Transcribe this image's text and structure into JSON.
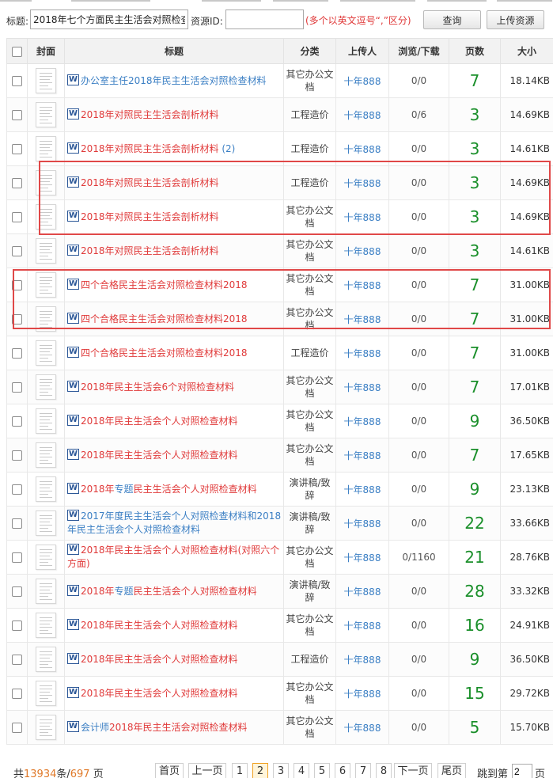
{
  "search": {
    "title_label": "标题:",
    "title_value": "2018年七个方面民主生活会对照检查材料",
    "id_label": "资源ID:",
    "id_value": "",
    "hint": "(多个以英文逗号“,”区分)",
    "query_button": "查询",
    "upload_button": "上传资源"
  },
  "table": {
    "columns": [
      "封面",
      "标题",
      "分类",
      "上传人",
      "浏览/下载",
      "页数",
      "大小"
    ],
    "rows": [
      {
        "title": "办公室主任2018年民主生活会对照检查材料",
        "title_color": "#3b7fc4",
        "category": "其它办公文档",
        "uploader": "十年888",
        "views": "0/0",
        "pages": "7",
        "size": "18.14KB"
      },
      {
        "title": "2018年对照民主生活会剖析材料",
        "category": "工程造价",
        "uploader": "十年888",
        "views": "0/6",
        "pages": "3",
        "size": "14.69KB"
      },
      {
        "title": "2018年对照民主生活会剖析材料",
        "suffix": " (2)",
        "category": "工程造价",
        "uploader": "十年888",
        "views": "0/0",
        "pages": "3",
        "size": "14.61KB"
      },
      {
        "title": "2018年对照民主生活会剖析材料",
        "category": "工程造价",
        "uploader": "十年888",
        "views": "0/0",
        "pages": "3",
        "size": "14.69KB"
      },
      {
        "title": "2018年对照民主生活会剖析材料",
        "category": "其它办公文档",
        "uploader": "十年888",
        "views": "0/0",
        "pages": "3",
        "size": "14.69KB"
      },
      {
        "title": "2018年对照民主生活会剖析材料",
        "category": "其它办公文档",
        "uploader": "十年888",
        "views": "0/0",
        "pages": "3",
        "size": "14.61KB"
      },
      {
        "title": "四个合格民主生活会对照检查材料2018",
        "category": "其它办公文档",
        "uploader": "十年888",
        "views": "0/0",
        "pages": "7",
        "size": "31.00KB"
      },
      {
        "title": "四个合格民主生活会对照检查材料2018",
        "category": "其它办公文档",
        "uploader": "十年888",
        "views": "0/0",
        "pages": "7",
        "size": "31.00KB"
      },
      {
        "title": "四个合格民主生活会对照检查材料2018",
        "category": "工程造价",
        "uploader": "十年888",
        "views": "0/0",
        "pages": "7",
        "size": "31.00KB"
      },
      {
        "title": "2018年民主生活会6个对照检查材料",
        "category": "其它办公文档",
        "uploader": "十年888",
        "views": "0/0",
        "pages": "7",
        "size": "17.01KB"
      },
      {
        "title": "2018年民主生活会个人对照检查材料",
        "category": "其它办公文档",
        "uploader": "十年888",
        "views": "0/0",
        "pages": "9",
        "size": "36.50KB"
      },
      {
        "title": "2018年民主生活会个人对照检查材料",
        "category": "其它办公文档",
        "uploader": "十年888",
        "views": "0/0",
        "pages": "7",
        "size": "17.65KB"
      },
      {
        "title_parts": [
          [
            "2018年",
            "r"
          ],
          [
            "专题",
            "b"
          ],
          [
            "民主生活会个人对照检查材料",
            "r"
          ]
        ],
        "title": "2018年专题民主生活会个人对照检查材料",
        "category": "演讲稿/致辞",
        "uploader": "十年888",
        "views": "0/0",
        "pages": "9",
        "size": "23.13KB"
      },
      {
        "title_parts": [
          [
            "2017年度民主生活会个人对照检查材料和2018年民主生活会个人对照检查材料",
            "b"
          ]
        ],
        "title": "2017年度民主生活会个人对照检查材料和2018年民主生活会个人对照检查材料",
        "category": "演讲稿/致辞",
        "uploader": "十年888",
        "views": "0/0",
        "pages": "22",
        "size": "33.66KB"
      },
      {
        "title": "2018年民主生活会个人对照检查材料(对照六个方面)",
        "category": "其它办公文档",
        "uploader": "十年888",
        "views": "0/1160",
        "pages": "21",
        "size": "28.76KB"
      },
      {
        "title_parts": [
          [
            "2018年",
            "r"
          ],
          [
            "专题",
            "b"
          ],
          [
            "民主生活会个人对照检查材料",
            "r"
          ]
        ],
        "title": "2018年专题民主生活会个人对照检查材料",
        "category": "演讲稿/致辞",
        "uploader": "十年888",
        "views": "0/0",
        "pages": "28",
        "size": "33.32KB"
      },
      {
        "title": "2018年民主生活会个人对照检查材料",
        "category": "其它办公文档",
        "uploader": "十年888",
        "views": "0/0",
        "pages": "16",
        "size": "24.91KB"
      },
      {
        "title": "2018年民主生活会个人对照检查材料",
        "category": "工程造价",
        "uploader": "十年888",
        "views": "0/0",
        "pages": "9",
        "size": "36.50KB"
      },
      {
        "title": "2018年民主生活会个人对照检查材料",
        "category": "其它办公文档",
        "uploader": "十年888",
        "views": "0/0",
        "pages": "15",
        "size": "29.72KB"
      },
      {
        "title_parts": [
          [
            "会计师",
            "b"
          ],
          [
            "2018年民主生活会对照检查材料",
            "r"
          ]
        ],
        "title": "会计师2018年民主生活会对照检查材料",
        "category": "其它办公文档",
        "uploader": "十年888",
        "views": "0/0",
        "pages": "5",
        "size": "15.70KB"
      }
    ]
  },
  "pagination": {
    "total_prefix": "共",
    "total_items": "13934",
    "items_unit": "条/",
    "total_pages": "697",
    "pages_unit": "页",
    "first": "首页",
    "prev": "上一页",
    "pages": [
      "1",
      "2",
      "3",
      "4",
      "5",
      "6",
      "7",
      "8"
    ],
    "current": "2",
    "next": "下一页",
    "last": "尾页",
    "jump_prefix": "跳到第",
    "jump_value": "2",
    "jump_suffix": "页"
  },
  "colors": {
    "title_red": "#e03a3a",
    "link_blue": "#3b7fc4",
    "pages_green": "#1a8f2a",
    "highlight_box": "#e04848",
    "current_page": "#f0a020"
  },
  "icons": {
    "word_doc": "word-doc-icon",
    "checkbox": "checkbox",
    "cover": "document-thumbnail"
  }
}
